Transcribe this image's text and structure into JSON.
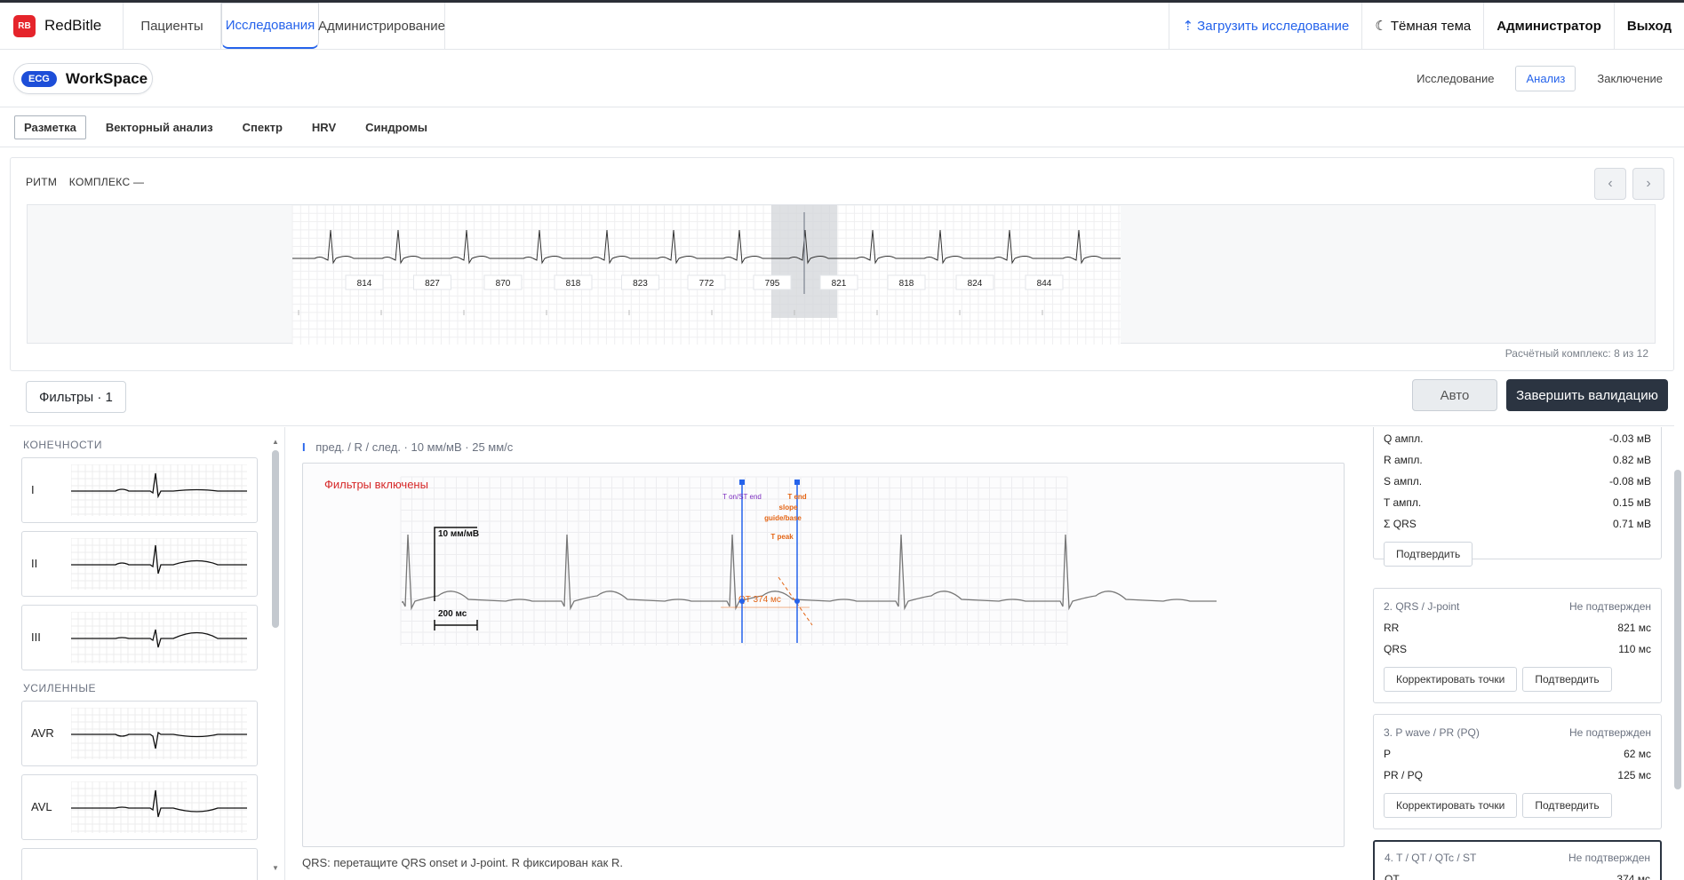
{
  "topnav": {
    "brand_logo": "RB",
    "brand_name": "RedBitle",
    "tabs": [
      {
        "label": "Пациенты"
      },
      {
        "label": "Исследования",
        "active": true
      },
      {
        "label": "Администрирование"
      }
    ],
    "upload": "⇡ Загрузить исследование",
    "theme": "☾ Тёмная тема",
    "user": "Администратор",
    "logout": "Выход"
  },
  "workspace": {
    "badge": "ECG",
    "title": "WorkSpace",
    "tabs": [
      {
        "label": "Исследование"
      },
      {
        "label": "Анализ",
        "active": true
      },
      {
        "label": "Заключение"
      }
    ]
  },
  "analysis_tabs": [
    {
      "label": "Разметка",
      "active": true
    },
    {
      "label": "Векторный анализ"
    },
    {
      "label": "Спектр"
    },
    {
      "label": "HRV"
    },
    {
      "label": "Синдромы"
    }
  ],
  "rhythm": {
    "label_rhythm": "РИТМ",
    "label_complex": "КОМПЛЕКС —",
    "prev": "‹",
    "next": "›",
    "rr_intervals": [
      "814",
      "827",
      "870",
      "818",
      "823",
      "772",
      "795",
      "821",
      "818",
      "824",
      "844"
    ],
    "selected_index": 7,
    "footer": "Расчётный комплекс: 8 из 12"
  },
  "filterbar": {
    "filters": "Фильтры · 1",
    "auto": "Авто",
    "finish": "Завершить валидацию"
  },
  "leads": {
    "groups": [
      {
        "title": "КОНЕЧНОСТИ",
        "items": [
          {
            "name": "I"
          },
          {
            "name": "II"
          },
          {
            "name": "III"
          }
        ]
      },
      {
        "title": "УСИЛЕННЫЕ",
        "items": [
          {
            "name": "AVR"
          },
          {
            "name": "AVL"
          }
        ]
      }
    ],
    "scroll_up": "▲",
    "scroll_down": "▼"
  },
  "center": {
    "lead": "I",
    "header": "пред. / R / след. · 10 мм/мВ · 25 мм/с",
    "filters_on": "Фильтры включены",
    "calib_amp": "10 мм/мВ",
    "calib_time": "200 мс",
    "marker_t_on": "T on/ST end",
    "marker_t_end": "T end",
    "marker_slope": "slope",
    "marker_guide": "guide/base",
    "marker_t_peak": "T peak",
    "qt_label": "QT 374 мс",
    "footer": "QRS: перетащите QRS onset и J-point. R фиксирован как R."
  },
  "right": {
    "card1": {
      "rows": [
        {
          "k": "Q ампл.",
          "v": "-0.03 мВ"
        },
        {
          "k": "R ампл.",
          "v": "0.82 мВ"
        },
        {
          "k": "S ампл.",
          "v": "-0.08 мВ"
        },
        {
          "k": "T ампл.",
          "v": "0.15 мВ"
        },
        {
          "k": "Σ QRS",
          "v": "0.71 мВ"
        }
      ],
      "confirm": "Подтвердить"
    },
    "card2": {
      "title": "2. QRS / J-point",
      "status": "Не подтвержден",
      "rows": [
        {
          "k": "RR",
          "v": "821 мс"
        },
        {
          "k": "QRS",
          "v": "110 мс"
        }
      ],
      "correct": "Корректировать точки",
      "confirm": "Подтвердить"
    },
    "card3": {
      "title": "3. P wave / PR (PQ)",
      "status": "Не подтвержден",
      "rows": [
        {
          "k": "P",
          "v": "62 мс"
        },
        {
          "k": "PR / PQ",
          "v": "125 мс"
        }
      ],
      "correct": "Корректировать точки",
      "confirm": "Подтвердить"
    },
    "card4": {
      "title": "4. T / QT / QTc / ST",
      "status": "Не подтвержден",
      "rows": [
        {
          "k": "QT",
          "v": "374 мс"
        }
      ]
    }
  },
  "colors": {
    "accent": "#2563eb",
    "brand": "#e5242b",
    "primary_dark": "#2b3441",
    "alert": "#d62828",
    "marker_orange": "#e36414",
    "marker_purple": "#7b2cbf"
  }
}
